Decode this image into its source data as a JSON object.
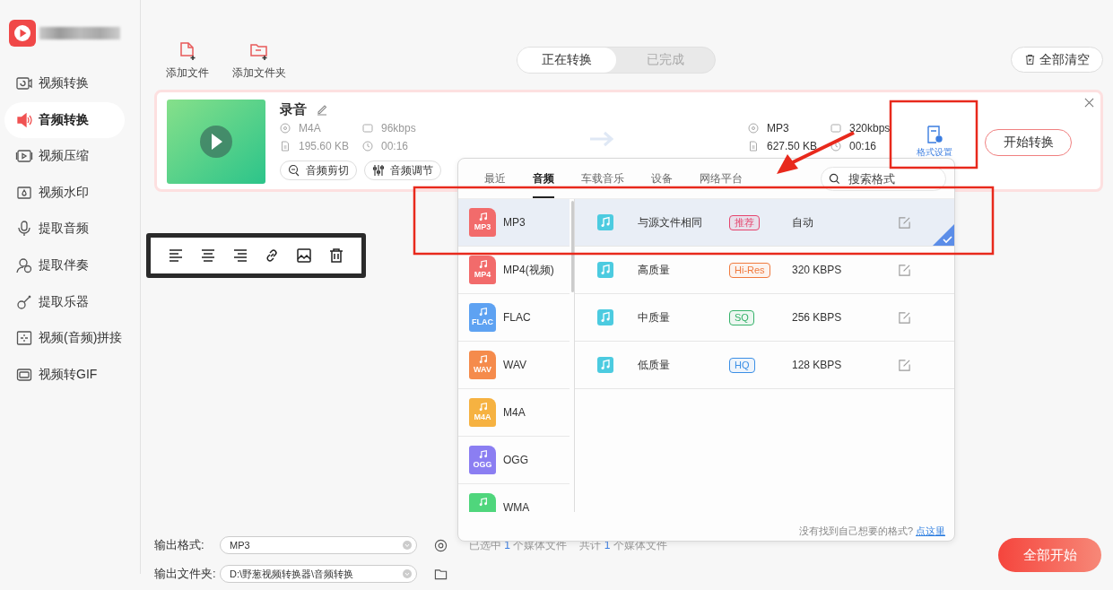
{
  "sidebar": {
    "nav": [
      {
        "label": "视频转换",
        "kind": "video",
        "selected": false
      },
      {
        "label": "音频转换",
        "kind": "audio",
        "selected": true
      },
      {
        "label": "视频压缩",
        "kind": "compress",
        "selected": false
      },
      {
        "label": "视频水印",
        "kind": "watermark",
        "selected": false
      },
      {
        "label": "提取音频",
        "kind": "mic",
        "selected": false
      },
      {
        "label": "提取伴奏",
        "kind": "vocal",
        "selected": false
      },
      {
        "label": "提取乐器",
        "kind": "guitar",
        "selected": false
      },
      {
        "label": "视频(音频)拼接",
        "kind": "merge",
        "selected": false
      },
      {
        "label": "视频转GIF",
        "kind": "gif",
        "selected": false
      }
    ]
  },
  "toolbar": [
    {
      "label": "添加文件",
      "kind": "file"
    },
    {
      "label": "添加文件夹",
      "kind": "folder"
    }
  ],
  "status_tabs": [
    {
      "label": "正在转换",
      "selected": true
    },
    {
      "label": "已完成",
      "selected": false
    }
  ],
  "clear_button": "全部清空",
  "task": {
    "title": "录音",
    "source": {
      "format": "M4A",
      "bitrate": "96kbps",
      "size": "195.60 KB",
      "duration": "00:16"
    },
    "target": {
      "format": "MP3",
      "bitrate": "320kbps",
      "size": "627.50 KB",
      "duration": "00:16"
    },
    "actions": [
      {
        "label": "音频剪切",
        "kind": "cut"
      },
      {
        "label": "音频调节",
        "kind": "adjust"
      }
    ],
    "format_settings": "格式设置",
    "start": "开始转换"
  },
  "floating_toolbar": [
    {
      "kind": "align-left"
    },
    {
      "kind": "align-center"
    },
    {
      "kind": "align-right"
    },
    {
      "kind": "link"
    },
    {
      "kind": "image"
    },
    {
      "kind": "delete"
    }
  ],
  "format_popup": {
    "tabs": [
      {
        "label": "最近",
        "selected": false
      },
      {
        "label": "音频",
        "selected": true
      },
      {
        "label": "车载音乐",
        "selected": false
      },
      {
        "label": "设备",
        "selected": false
      },
      {
        "label": "网络平台",
        "selected": false
      }
    ],
    "search": {
      "placeholder": "搜索格式"
    },
    "formats": [
      {
        "name": "MP3",
        "icon_label": "MP3",
        "color": "#f26b6b",
        "selected": true
      },
      {
        "name": "MP4(视频)",
        "icon_label": "MP4",
        "color": "#f26b6b",
        "selected": false
      },
      {
        "name": "FLAC",
        "icon_label": "FLAC",
        "color": "#5ea2f2",
        "selected": false
      },
      {
        "name": "WAV",
        "icon_label": "WAV",
        "color": "#f58b4c",
        "selected": false
      },
      {
        "name": "M4A",
        "icon_label": "M4A",
        "color": "#f6b241",
        "selected": false
      },
      {
        "name": "OGG",
        "icon_label": "OGG",
        "color": "#8b7ef2",
        "selected": false
      },
      {
        "name": "WMA",
        "color": "#4fd67c",
        "selected": false
      }
    ],
    "presets": [
      {
        "name": "与源文件相同",
        "badge": "推荐",
        "color": "#e5446d",
        "bitrate": "自动",
        "selected": true
      },
      {
        "name": "高质量",
        "badge": "Hi-Res",
        "color": "#f07a3e",
        "bitrate": "320 KBPS",
        "selected": false
      },
      {
        "name": "中质量",
        "badge": "SQ",
        "color": "#35b26a",
        "bitrate": "256 KBPS",
        "selected": false
      },
      {
        "name": "低质量",
        "badge": "HQ",
        "color": "#3b8fe6",
        "bitrate": "128 KBPS",
        "selected": false
      }
    ],
    "footer": {
      "text": "没有找到自己想要的格式?",
      "link": "点这里"
    }
  },
  "output": {
    "format_label": "输出格式:",
    "format": "MP3",
    "folder_label": "输出文件夹:",
    "folder": "D:\\野葱视频转换器\\音频转换"
  },
  "status": [
    {
      "before": "已选中",
      "count": "1",
      "after": "个媒体文件"
    },
    {
      "before": "共计",
      "count": "1",
      "after": "个媒体文件"
    }
  ],
  "start_all": "全部开始"
}
